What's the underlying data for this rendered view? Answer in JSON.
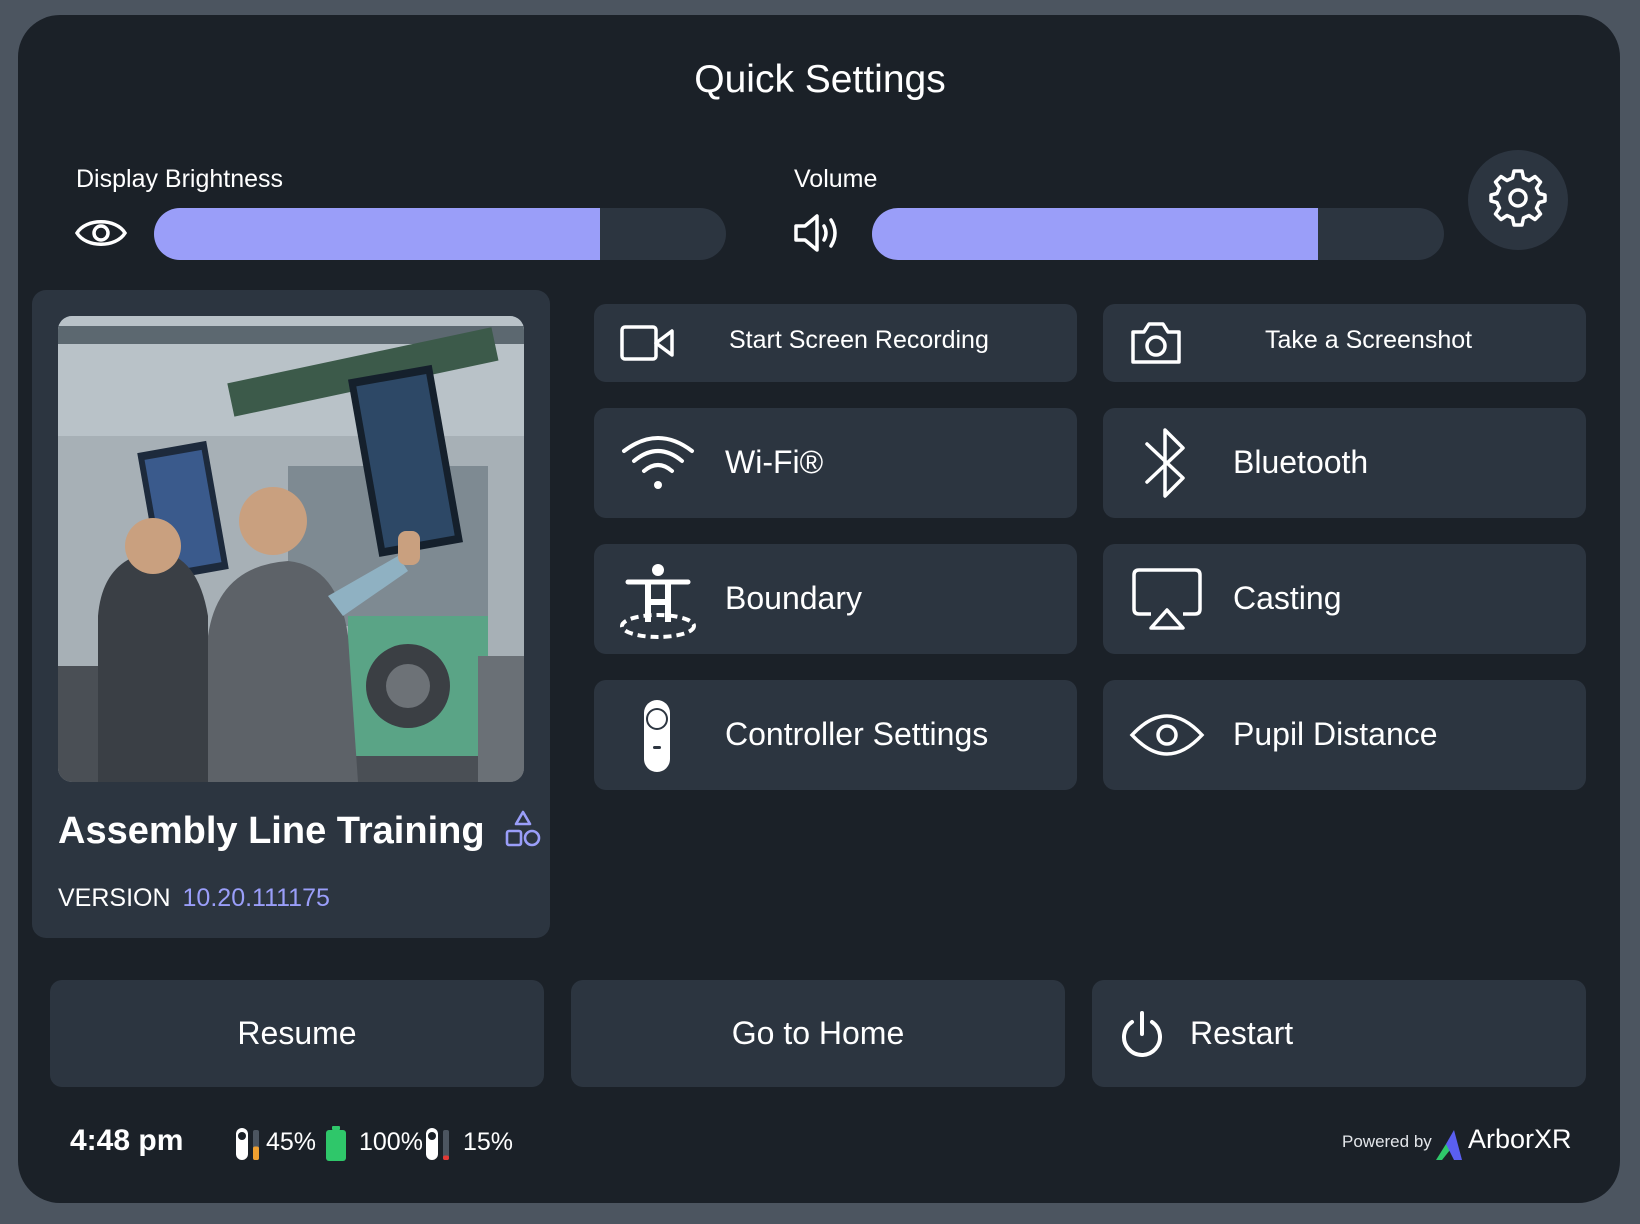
{
  "title": "Quick Settings",
  "sliders": {
    "brightness": {
      "label": "Display Brightness",
      "level_percent": 78,
      "icon": "eye-icon"
    },
    "volume": {
      "label": "Volume",
      "level_percent": 78,
      "icon": "speaker-icon"
    }
  },
  "settings_icon": "gear-icon",
  "app": {
    "name": "Assembly Line Training",
    "version_label": "VERSION",
    "version": "10.20.111175",
    "badge_icon": "shapes-icon"
  },
  "tiles": [
    {
      "label": "Start Screen Recording",
      "icon": "video-camera-icon"
    },
    {
      "label": "Take a Screenshot",
      "icon": "camera-icon"
    },
    {
      "label": "Wi-Fi®",
      "icon": "wifi-icon"
    },
    {
      "label": "Bluetooth",
      "icon": "bluetooth-icon"
    },
    {
      "label": "Boundary",
      "icon": "boundary-icon"
    },
    {
      "label": "Casting",
      "icon": "casting-icon"
    },
    {
      "label": "Controller Settings",
      "icon": "controller-icon"
    },
    {
      "label": "Pupil Distance",
      "icon": "eye-icon"
    }
  ],
  "bottom": {
    "resume": "Resume",
    "home": "Go to Home",
    "restart": "Restart"
  },
  "status": {
    "time": "4:48 pm",
    "left_controller": "45%",
    "headset": "100%",
    "right_controller": "15%",
    "colors": {
      "left": "#f0a030",
      "headset": "#2fc76a",
      "right": "#e53935"
    }
  },
  "footer": {
    "powered_by": "Powered by",
    "brand": "ArborXR"
  },
  "colors": {
    "accent": "#9a9ef9",
    "panel": "#1b2128",
    "tile": "#2c3540"
  }
}
